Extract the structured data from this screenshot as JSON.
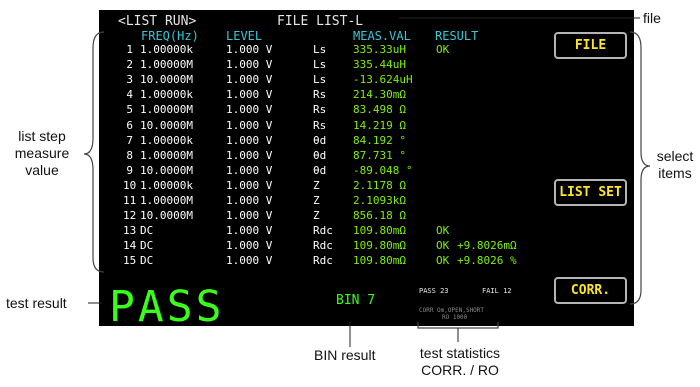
{
  "screen": {
    "mode_title": "<LIST RUN>",
    "file_title": "FILE LIST-L",
    "columns": {
      "freq": "FREQ(Hz)",
      "level": "LEVEL",
      "meas": "MEAS.VAL",
      "result": "RESULT"
    },
    "rows": [
      {
        "no": "1",
        "freq": "1.00000k",
        "level": "1.000 V",
        "param": "Ls",
        "value": "335.33uH",
        "result": "OK",
        "extra": ""
      },
      {
        "no": "2",
        "freq": "1.00000M",
        "level": "1.000 V",
        "param": "Ls",
        "value": "335.44uH",
        "result": "",
        "extra": ""
      },
      {
        "no": "3",
        "freq": "10.0000M",
        "level": "1.000 V",
        "param": "Ls",
        "value": "-13.624uH",
        "result": "",
        "extra": ""
      },
      {
        "no": "4",
        "freq": "1.00000k",
        "level": "1.000 V",
        "param": "Rs",
        "value": "214.30mΩ",
        "result": "",
        "extra": ""
      },
      {
        "no": "5",
        "freq": "1.00000M",
        "level": "1.000 V",
        "param": "Rs",
        "value": "83.498 Ω",
        "result": "",
        "extra": ""
      },
      {
        "no": "6",
        "freq": "10.0000M",
        "level": "1.000 V",
        "param": "Rs",
        "value": "14.219 Ω",
        "result": "",
        "extra": ""
      },
      {
        "no": "7",
        "freq": "1.00000k",
        "level": "1.000 V",
        "param": "θd",
        "value": "84.192 °",
        "result": "",
        "extra": ""
      },
      {
        "no": "8",
        "freq": "1.00000M",
        "level": "1.000 V",
        "param": "θd",
        "value": "87.731 °",
        "result": "",
        "extra": ""
      },
      {
        "no": "9",
        "freq": "10.0000M",
        "level": "1.000 V",
        "param": "θd",
        "value": "-89.048 °",
        "result": "",
        "extra": ""
      },
      {
        "no": "10",
        "freq": "1.00000k",
        "level": "1.000 V",
        "param": "Z",
        "value": "2.1178 Ω",
        "result": "",
        "extra": ""
      },
      {
        "no": "11",
        "freq": "1.00000M",
        "level": "1.000 V",
        "param": "Z",
        "value": "2.1093kΩ",
        "result": "",
        "extra": ""
      },
      {
        "no": "12",
        "freq": "10.0000M",
        "level": "1.000 V",
        "param": "Z",
        "value": "856.18 Ω",
        "result": "",
        "extra": ""
      },
      {
        "no": "13",
        "freq": "DC",
        "level": "1.000 V",
        "param": "Rdc",
        "value": "109.80mΩ",
        "result": "OK",
        "extra": ""
      },
      {
        "no": "14",
        "freq": "DC",
        "level": "1.000 V",
        "param": "Rdc",
        "value": "109.80mΩ",
        "result": "OK",
        "extra": "+9.8026mΩ"
      },
      {
        "no": "15",
        "freq": "DC",
        "level": "1.000 V",
        "param": "Rdc",
        "value": "109.80mΩ",
        "result": "OK",
        "extra": "+9.8026 %"
      }
    ],
    "softkeys": {
      "file": "FILE",
      "list_set": "LIST SET",
      "corr": "CORR."
    },
    "judgement": "PASS",
    "bin": "BIN 7",
    "stats": {
      "pass": "PASS 23",
      "fail": "FAIL 12"
    },
    "corr_line": "CORR Om,OPEN,SHORT",
    "ro_line": "RO 1000",
    "colors": {
      "screen_bg": "#000000",
      "softkey_text": "#ffe62a",
      "pass_green": "#3aff1a",
      "value_green": "#7ff000",
      "header_cyan": "#35c8d8"
    }
  },
  "annotations": {
    "file": "file",
    "list_step": [
      "list step",
      "measure",
      "value"
    ],
    "select_items": [
      "select",
      "items"
    ],
    "test_result": "test result",
    "bin_result": "BIN result",
    "test_statistics": [
      "test statistics",
      "CORR. / RO"
    ]
  }
}
